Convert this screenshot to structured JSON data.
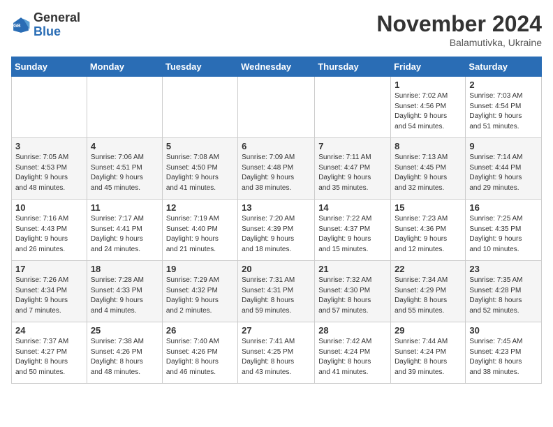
{
  "logo": {
    "line1": "General",
    "line2": "Blue"
  },
  "title": "November 2024",
  "subtitle": "Balamutivka, Ukraine",
  "days_header": [
    "Sunday",
    "Monday",
    "Tuesday",
    "Wednesday",
    "Thursday",
    "Friday",
    "Saturday"
  ],
  "weeks": [
    [
      {
        "day": "",
        "info": ""
      },
      {
        "day": "",
        "info": ""
      },
      {
        "day": "",
        "info": ""
      },
      {
        "day": "",
        "info": ""
      },
      {
        "day": "",
        "info": ""
      },
      {
        "day": "1",
        "info": "Sunrise: 7:02 AM\nSunset: 4:56 PM\nDaylight: 9 hours\nand 54 minutes."
      },
      {
        "day": "2",
        "info": "Sunrise: 7:03 AM\nSunset: 4:54 PM\nDaylight: 9 hours\nand 51 minutes."
      }
    ],
    [
      {
        "day": "3",
        "info": "Sunrise: 7:05 AM\nSunset: 4:53 PM\nDaylight: 9 hours\nand 48 minutes."
      },
      {
        "day": "4",
        "info": "Sunrise: 7:06 AM\nSunset: 4:51 PM\nDaylight: 9 hours\nand 45 minutes."
      },
      {
        "day": "5",
        "info": "Sunrise: 7:08 AM\nSunset: 4:50 PM\nDaylight: 9 hours\nand 41 minutes."
      },
      {
        "day": "6",
        "info": "Sunrise: 7:09 AM\nSunset: 4:48 PM\nDaylight: 9 hours\nand 38 minutes."
      },
      {
        "day": "7",
        "info": "Sunrise: 7:11 AM\nSunset: 4:47 PM\nDaylight: 9 hours\nand 35 minutes."
      },
      {
        "day": "8",
        "info": "Sunrise: 7:13 AM\nSunset: 4:45 PM\nDaylight: 9 hours\nand 32 minutes."
      },
      {
        "day": "9",
        "info": "Sunrise: 7:14 AM\nSunset: 4:44 PM\nDaylight: 9 hours\nand 29 minutes."
      }
    ],
    [
      {
        "day": "10",
        "info": "Sunrise: 7:16 AM\nSunset: 4:43 PM\nDaylight: 9 hours\nand 26 minutes."
      },
      {
        "day": "11",
        "info": "Sunrise: 7:17 AM\nSunset: 4:41 PM\nDaylight: 9 hours\nand 24 minutes."
      },
      {
        "day": "12",
        "info": "Sunrise: 7:19 AM\nSunset: 4:40 PM\nDaylight: 9 hours\nand 21 minutes."
      },
      {
        "day": "13",
        "info": "Sunrise: 7:20 AM\nSunset: 4:39 PM\nDaylight: 9 hours\nand 18 minutes."
      },
      {
        "day": "14",
        "info": "Sunrise: 7:22 AM\nSunset: 4:37 PM\nDaylight: 9 hours\nand 15 minutes."
      },
      {
        "day": "15",
        "info": "Sunrise: 7:23 AM\nSunset: 4:36 PM\nDaylight: 9 hours\nand 12 minutes."
      },
      {
        "day": "16",
        "info": "Sunrise: 7:25 AM\nSunset: 4:35 PM\nDaylight: 9 hours\nand 10 minutes."
      }
    ],
    [
      {
        "day": "17",
        "info": "Sunrise: 7:26 AM\nSunset: 4:34 PM\nDaylight: 9 hours\nand 7 minutes."
      },
      {
        "day": "18",
        "info": "Sunrise: 7:28 AM\nSunset: 4:33 PM\nDaylight: 9 hours\nand 4 minutes."
      },
      {
        "day": "19",
        "info": "Sunrise: 7:29 AM\nSunset: 4:32 PM\nDaylight: 9 hours\nand 2 minutes."
      },
      {
        "day": "20",
        "info": "Sunrise: 7:31 AM\nSunset: 4:31 PM\nDaylight: 8 hours\nand 59 minutes."
      },
      {
        "day": "21",
        "info": "Sunrise: 7:32 AM\nSunset: 4:30 PM\nDaylight: 8 hours\nand 57 minutes."
      },
      {
        "day": "22",
        "info": "Sunrise: 7:34 AM\nSunset: 4:29 PM\nDaylight: 8 hours\nand 55 minutes."
      },
      {
        "day": "23",
        "info": "Sunrise: 7:35 AM\nSunset: 4:28 PM\nDaylight: 8 hours\nand 52 minutes."
      }
    ],
    [
      {
        "day": "24",
        "info": "Sunrise: 7:37 AM\nSunset: 4:27 PM\nDaylight: 8 hours\nand 50 minutes."
      },
      {
        "day": "25",
        "info": "Sunrise: 7:38 AM\nSunset: 4:26 PM\nDaylight: 8 hours\nand 48 minutes."
      },
      {
        "day": "26",
        "info": "Sunrise: 7:40 AM\nSunset: 4:26 PM\nDaylight: 8 hours\nand 46 minutes."
      },
      {
        "day": "27",
        "info": "Sunrise: 7:41 AM\nSunset: 4:25 PM\nDaylight: 8 hours\nand 43 minutes."
      },
      {
        "day": "28",
        "info": "Sunrise: 7:42 AM\nSunset: 4:24 PM\nDaylight: 8 hours\nand 41 minutes."
      },
      {
        "day": "29",
        "info": "Sunrise: 7:44 AM\nSunset: 4:24 PM\nDaylight: 8 hours\nand 39 minutes."
      },
      {
        "day": "30",
        "info": "Sunrise: 7:45 AM\nSunset: 4:23 PM\nDaylight: 8 hours\nand 38 minutes."
      }
    ]
  ]
}
